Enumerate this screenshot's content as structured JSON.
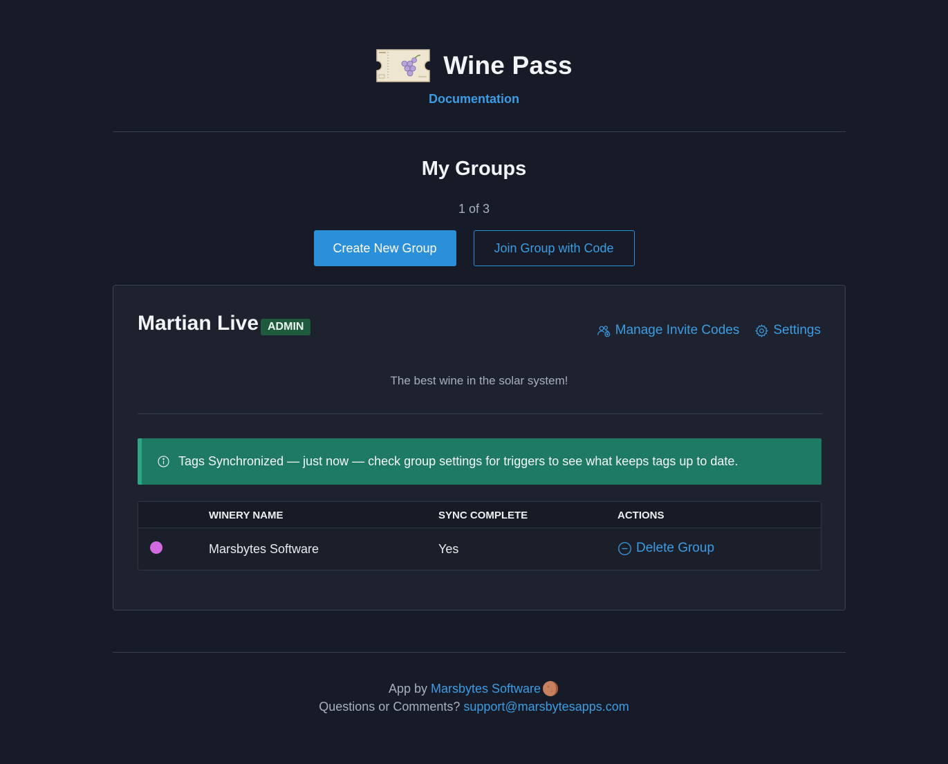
{
  "header": {
    "app_title": "Wine Pass",
    "documentation_link": "Documentation"
  },
  "groups": {
    "title": "My Groups",
    "counter": "1 of 3",
    "create_button": "Create New Group",
    "join_button": "Join Group with Code"
  },
  "group": {
    "name": "Martian Live",
    "role_badge": "ADMIN",
    "manage_invites_label": "Manage Invite Codes",
    "settings_label": "Settings",
    "description": "The best wine in the solar system!",
    "alert_text": "Tags Synchronized — just now — check group settings for triggers to see what keeps tags up to date.",
    "table": {
      "columns": [
        "WINERY NAME",
        "SYNC COMPLETE",
        "ACTIONS"
      ],
      "rows": [
        {
          "winery": "Marsbytes Software",
          "sync_complete": "Yes",
          "action": "Delete Group",
          "status_color": "#d36be0"
        }
      ]
    }
  },
  "footer": {
    "app_by_prefix": "App by",
    "company_link": "Marsbytes Software",
    "questions_prefix": "Questions or Comments?",
    "support_email": "support@marsbytesapps.com"
  },
  "colors": {
    "background": "#161b27",
    "accent": "#2c8fd9",
    "link": "#3d9ce3",
    "alert": "#1f7a64",
    "badge": "#1f5a3d"
  },
  "icons": [
    "ticket-grapes-logo",
    "users-invite-icon",
    "gear-icon",
    "info-icon",
    "minus-circle-icon",
    "mars-planet-icon"
  ]
}
